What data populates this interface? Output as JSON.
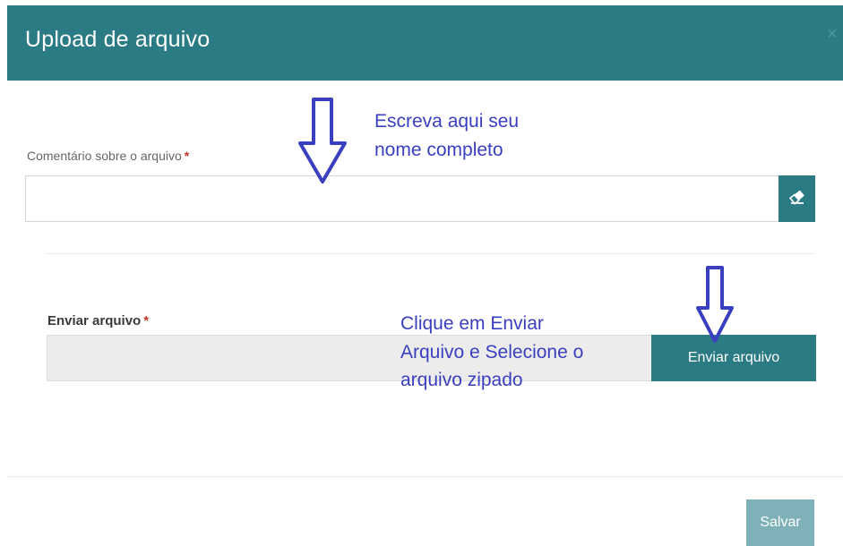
{
  "modal": {
    "title": "Upload de arquivo",
    "close_glyph": "×"
  },
  "comment_field": {
    "label": "Comentário sobre o arquivo",
    "required_mark": "*",
    "value": "",
    "placeholder": "",
    "clear_icon": "eraser-icon"
  },
  "upload_field": {
    "label": "Enviar arquivo",
    "required_mark": "*",
    "value": "",
    "button_label": "Enviar arquivo"
  },
  "footer": {
    "save_label": "Salvar"
  },
  "annotations": {
    "name_hint": [
      "Escreva aqui seu",
      "nome completo"
    ],
    "upload_hint": [
      "Clique em Enviar",
      "Arquivo e Selecione o",
      "arquivo zipado"
    ]
  },
  "colors": {
    "header": "#2b7b85",
    "primary_button": "#2b7b85",
    "save_button_disabled": "#7fb1b8",
    "required": "#c0392b",
    "annotation": "#3a3fbf"
  }
}
